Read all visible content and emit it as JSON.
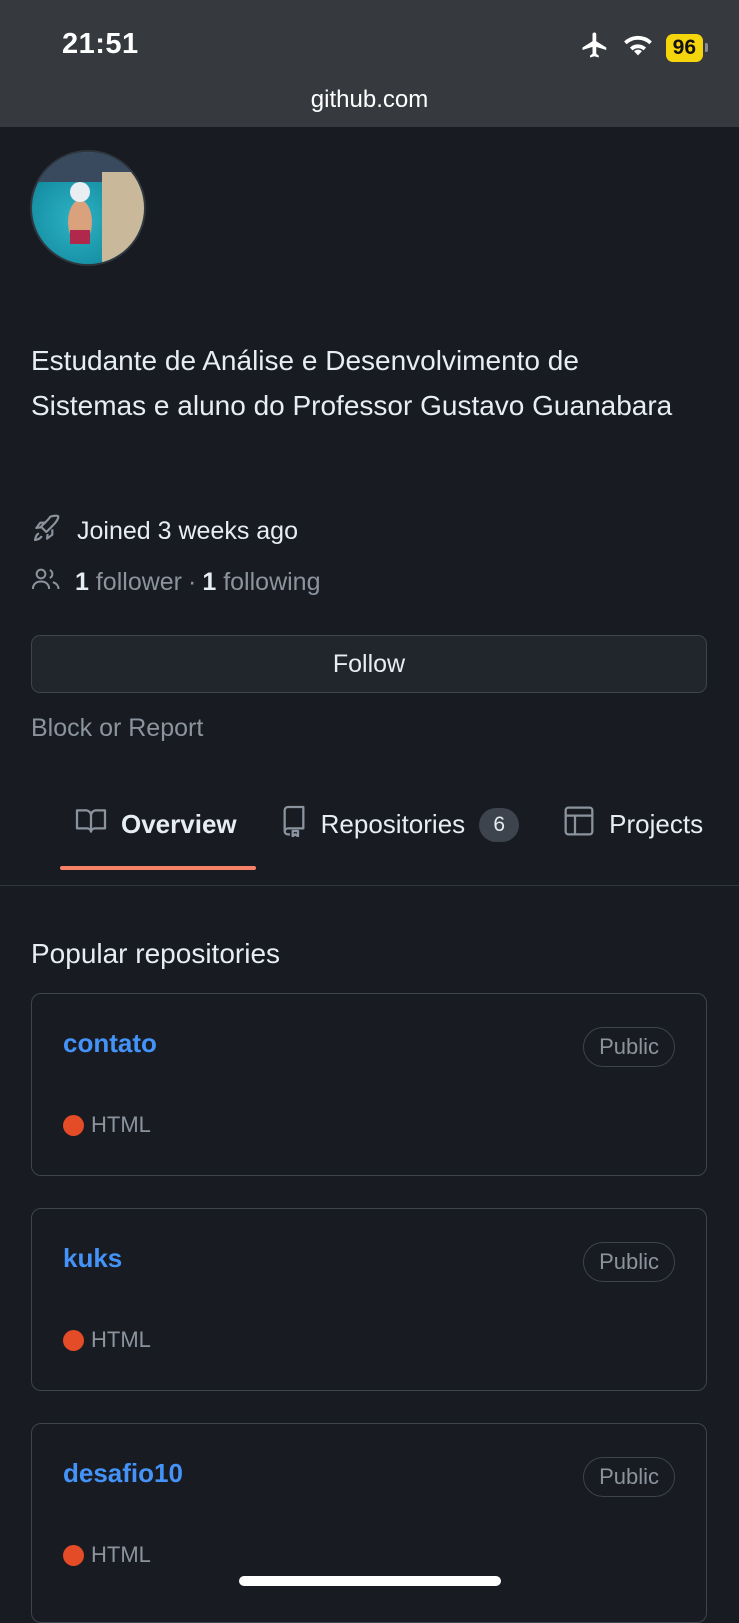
{
  "status_bar": {
    "time": "21:51",
    "battery": "96"
  },
  "browser": {
    "url": "github.com"
  },
  "profile": {
    "bio": "Estudante de Análise e Desenvolvimento de Sistemas e aluno do Professor Gustavo Guanabara",
    "joined": "Joined 3 weeks ago",
    "followers_count": "1",
    "followers_label": "follower",
    "separator": "·",
    "following_count": "1",
    "following_label": "following",
    "follow_button": "Follow",
    "block_report": "Block or Report"
  },
  "tabs": [
    {
      "label": "Overview",
      "icon": "book-icon",
      "active": true
    },
    {
      "label": "Repositories",
      "icon": "repo-icon",
      "counter": "6"
    },
    {
      "label": "Projects",
      "icon": "table-icon"
    }
  ],
  "popular": {
    "title": "Popular repositories",
    "repos": [
      {
        "name": "contato",
        "visibility": "Public",
        "language": "HTML",
        "language_color": "#e34c26"
      },
      {
        "name": "kuks",
        "visibility": "Public",
        "language": "HTML",
        "language_color": "#e34c26"
      },
      {
        "name": "desafio10",
        "visibility": "Public",
        "language": "HTML",
        "language_color": "#e34c26"
      }
    ]
  },
  "colors": {
    "background": "#181b21",
    "link": "#4493f8",
    "tab_underline": "#f78166",
    "battery": "#f5d50c"
  }
}
